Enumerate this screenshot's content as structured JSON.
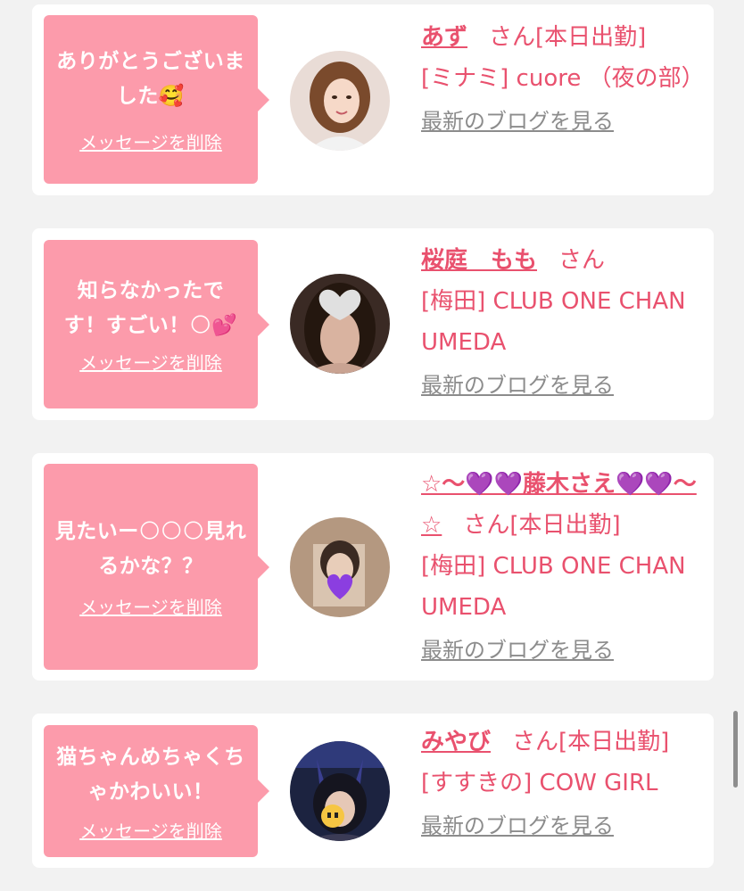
{
  "items": [
    {
      "message": "ありがとうございました🥰",
      "delete_label": "メッセージを削除",
      "name": "あず",
      "honorific": "さん",
      "status": "[本日出勤]",
      "shop": "[ミナミ] cuore （夜の部）",
      "blog_label": "最新のブログを見る"
    },
    {
      "message": "知らなかったです！すごい！🌕💕",
      "delete_label": "メッセージを削除",
      "name": "桜庭　もも",
      "honorific": "さん",
      "status": "",
      "shop": "[梅田] CLUB ONE CHAN UMEDA",
      "blog_label": "最新のブログを見る"
    },
    {
      "message": "見たいー🌕🌕🌕見れるかな？？",
      "delete_label": "メッセージを削除",
      "name": "☆〜💜💜藤木さえ💜💜〜☆",
      "honorific": "さん",
      "status": "[本日出勤]",
      "shop": "[梅田] CLUB ONE CHAN UMEDA",
      "blog_label": "最新のブログを見る"
    },
    {
      "message": "猫ちゃんめちゃくちゃかわいい！",
      "delete_label": "メッセージを削除",
      "name": "みやび",
      "honorific": "さん",
      "status": "[本日出勤]",
      "shop": "[すすきの] COW GIRL",
      "blog_label": "最新のブログを見る"
    }
  ],
  "colors": {
    "page_bg": "#f2f2f2",
    "card_bg": "#ffffff",
    "bubble_bg": "#fc9bab",
    "accent": "#e9516e",
    "link_gray": "#8c8c8c"
  },
  "icons": [
    "avatar-photo",
    "scrollbar"
  ]
}
